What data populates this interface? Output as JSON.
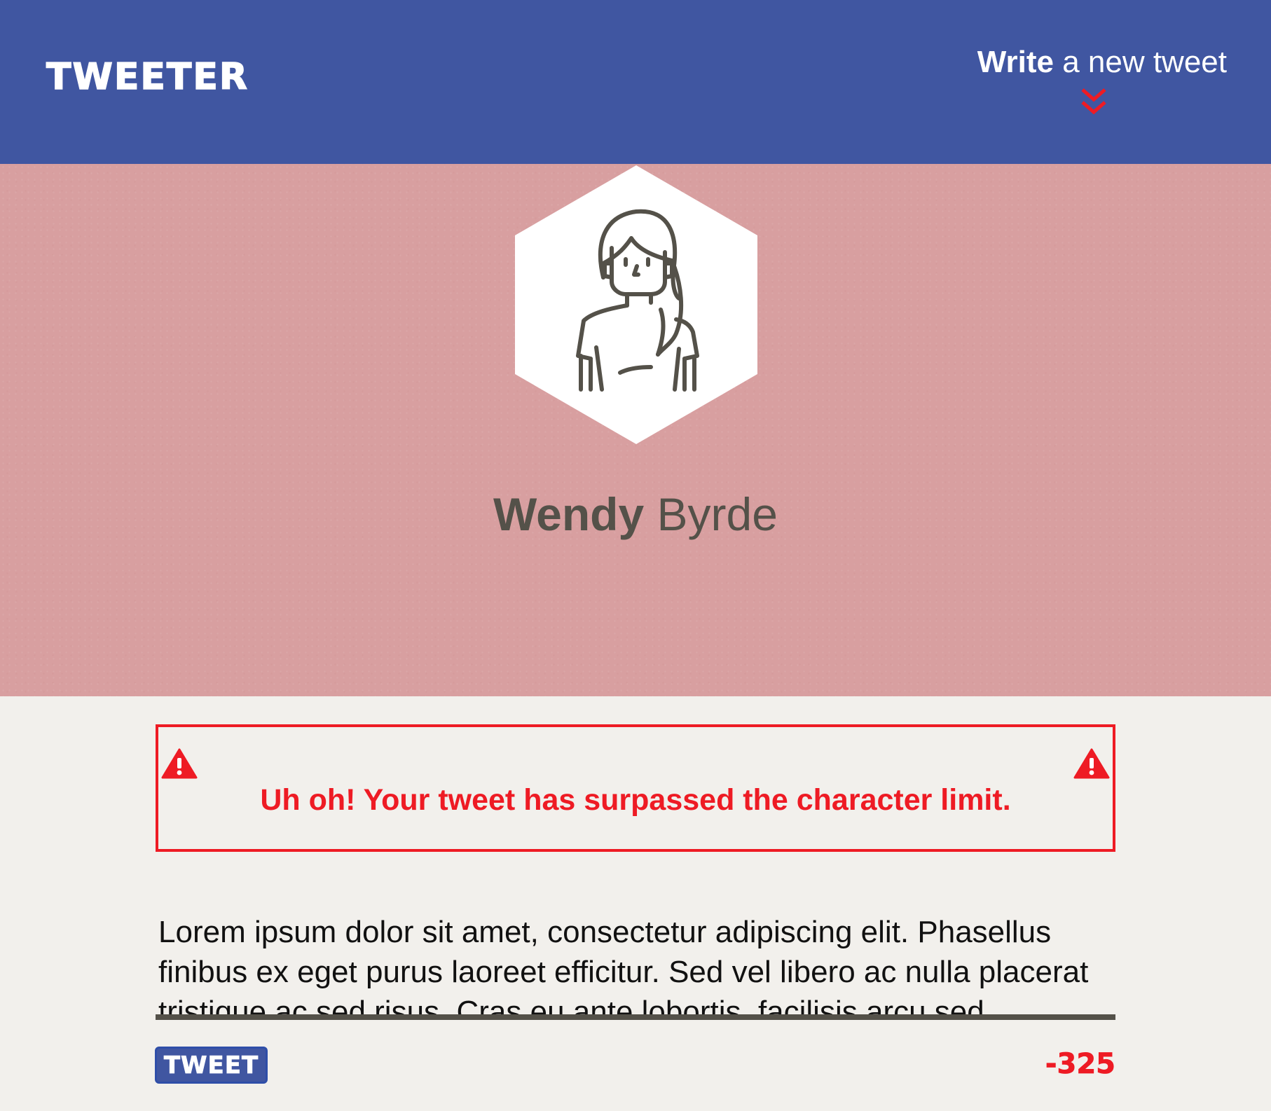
{
  "nav": {
    "logo": "TWEETER",
    "compose_bold": "Write",
    "compose_rest": " a new tweet",
    "compose_icon": "double-chevron-down-icon",
    "background": "#4056a1"
  },
  "profile": {
    "first_name": "Wendy",
    "last_name": " Byrde",
    "avatar_icon": "woman-avatar-icon",
    "background": "#d89fa0"
  },
  "error": {
    "message": "Uh oh! Your tweet has surpassed the character limit.",
    "icon": "warning-icon",
    "color": "#ee1b24"
  },
  "composer": {
    "text": "Lorem ipsum dolor sit amet, consectetur adipiscing elit. Phasellus finibus ex eget purus laoreet efficitur. Sed vel libero ac nulla placerat tristique ac sed risus. Cras eu ante lobortis, facilisis arcu sed",
    "button_label": "TWEET",
    "counter": "-325"
  },
  "colors": {
    "primary": "#4056a1",
    "error": "#ee1b24",
    "text_dark": "#545149",
    "page_bg": "#f2f0ec"
  }
}
